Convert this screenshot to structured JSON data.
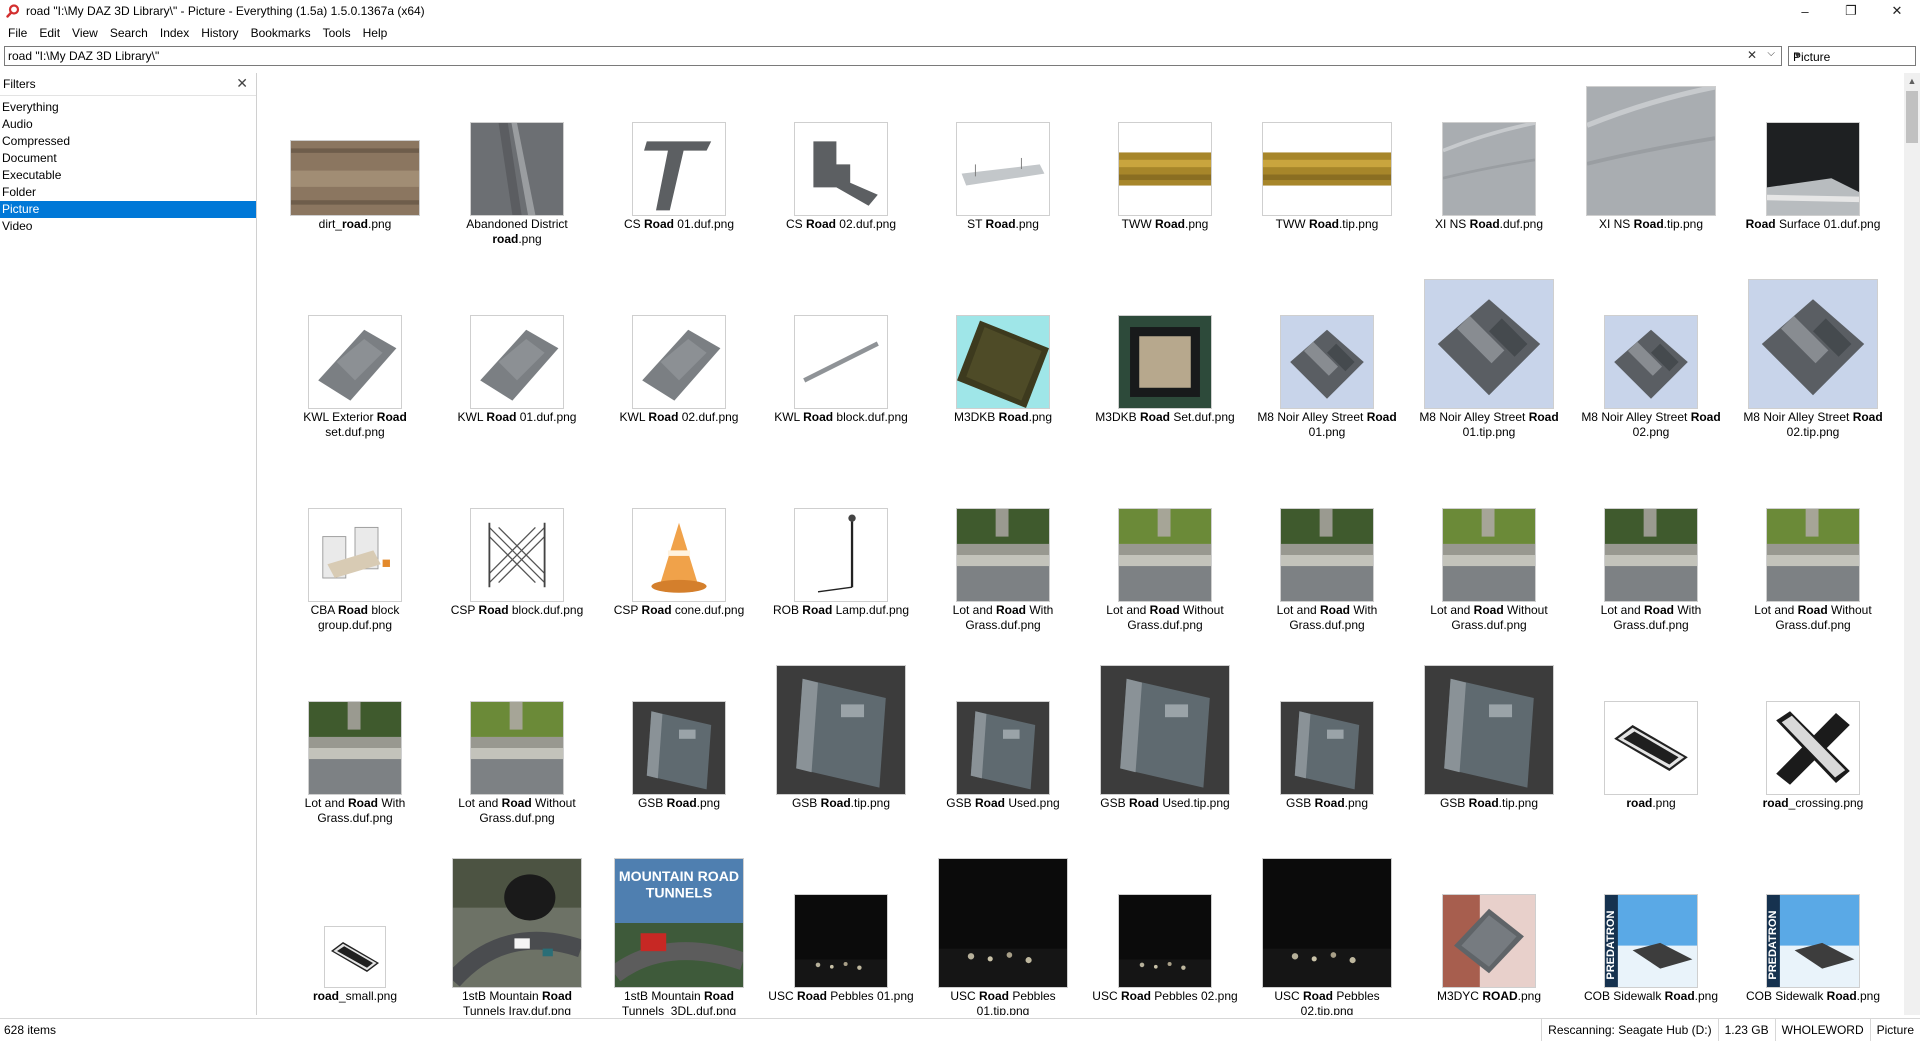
{
  "window": {
    "title": "road \"I:\\My DAZ 3D Library\\\"  - Picture - Everything (1.5a) 1.5.0.1367a (x64)",
    "buttons": {
      "minimize": "–",
      "maximize": "❐",
      "close": "✕"
    }
  },
  "menu": [
    "File",
    "Edit",
    "View",
    "Search",
    "Index",
    "History",
    "Bookmarks",
    "Tools",
    "Help"
  ],
  "search": {
    "value": "road \"I:\\My DAZ 3D Library\\\"",
    "clear_glyph": "✕",
    "dropdown_glyph": "⌵"
  },
  "filter_select": {
    "value": "Picture"
  },
  "sidebar": {
    "title": "Filters",
    "close_glyph": "✕",
    "items": [
      "Everything",
      "Audio",
      "Compressed",
      "Document",
      "Executable",
      "Folder",
      "Picture",
      "Video"
    ],
    "selected": "Picture"
  },
  "files": [
    {
      "pre": "dirt_",
      "bold": "road",
      "post": ".png",
      "thumb": "dirt",
      "w": 128,
      "h": 74
    },
    {
      "pre": "Abandoned District ",
      "bold": "road",
      "post": ".png",
      "thumb": "gray-dark",
      "w": 92,
      "h": 92
    },
    {
      "pre": "CS ",
      "bold": "Road",
      "post": " 01.duf.png",
      "thumb": "piece-t",
      "w": 92,
      "h": 92
    },
    {
      "pre": "CS ",
      "bold": "Road",
      "post": " 02.duf.png",
      "thumb": "piece-l",
      "w": 92,
      "h": 92
    },
    {
      "pre": "ST ",
      "bold": "Road",
      "post": ".png",
      "thumb": "piece-flat",
      "w": 92,
      "h": 92
    },
    {
      "pre": "TWW ",
      "bold": "Road",
      "post": ".png",
      "thumb": "yellow-strip",
      "w": 92,
      "h": 92
    },
    {
      "pre": "TWW ",
      "bold": "Road",
      "post": ".tip.png",
      "thumb": "yellow-strip",
      "w": 128,
      "h": 92
    },
    {
      "pre": "XI NS ",
      "bold": "Road",
      "post": ".duf.png",
      "thumb": "asphalt-light",
      "w": 92,
      "h": 92
    },
    {
      "pre": "XI NS ",
      "bold": "Road",
      "post": ".tip.png",
      "thumb": "asphalt-light",
      "w": 128,
      "h": 128
    },
    {
      "pre": "",
      "bold": "Road",
      "post": " Surface 01.duf.png",
      "thumb": "black-tile",
      "w": 92,
      "h": 92
    },
    {
      "pre": "KWL Exterior ",
      "bold": "Road",
      "post": " set.duf.png",
      "thumb": "slab",
      "w": 92,
      "h": 92
    },
    {
      "pre": "KWL ",
      "bold": "Road",
      "post": " 01.duf.png",
      "thumb": "slab",
      "w": 92,
      "h": 92
    },
    {
      "pre": "KWL ",
      "bold": "Road",
      "post": " 02.duf.png",
      "thumb": "slab",
      "w": 92,
      "h": 92
    },
    {
      "pre": "KWL ",
      "bold": "Road",
      "post": " block.duf.png",
      "thumb": "stick",
      "w": 92,
      "h": 92
    },
    {
      "pre": "M3DKB ",
      "bold": "Road",
      "post": ".png",
      "thumb": "cyan-tile",
      "w": 92,
      "h": 92
    },
    {
      "pre": "M3DKB ",
      "bold": "Road",
      "post": " Set.duf.png",
      "thumb": "green-tile",
      "w": 92,
      "h": 92
    },
    {
      "pre": "M8 Noir Alley Street ",
      "bold": "Road",
      "post": " 01.png",
      "thumb": "noir",
      "w": 92,
      "h": 92
    },
    {
      "pre": "M8 Noir Alley Street ",
      "bold": "Road",
      "post": " 01.tip.png",
      "thumb": "noir",
      "w": 128,
      "h": 128
    },
    {
      "pre": "M8 Noir Alley Street ",
      "bold": "Road",
      "post": " 02.png",
      "thumb": "noir",
      "w": 92,
      "h": 92
    },
    {
      "pre": "M8 Noir Alley Street ",
      "bold": "Road",
      "post": " 02.tip.png",
      "thumb": "noir",
      "w": 128,
      "h": 128
    },
    {
      "pre": "CBA ",
      "bold": "Road",
      "post": " block group.duf.png",
      "thumb": "barrier",
      "w": 92,
      "h": 92
    },
    {
      "pre": "CSP ",
      "bold": "Road",
      "post": " block.duf.png",
      "thumb": "fence",
      "w": 92,
      "h": 92
    },
    {
      "pre": "CSP ",
      "bold": "Road",
      "post": " cone.duf.png",
      "thumb": "cone",
      "w": 92,
      "h": 92
    },
    {
      "pre": "ROB ",
      "bold": "Road",
      "post": " Lamp.duf.png",
      "thumb": "lamp",
      "w": 92,
      "h": 92
    },
    {
      "pre": "Lot and ",
      "bold": "Road",
      "post": " With Grass.duf.png",
      "thumb": "grass-dark",
      "w": 92,
      "h": 92
    },
    {
      "pre": "Lot and ",
      "bold": "Road",
      "post": " Without Grass.duf.png",
      "thumb": "grass-light",
      "w": 92,
      "h": 92
    },
    {
      "pre": "Lot and ",
      "bold": "Road",
      "post": " With Grass.duf.png",
      "thumb": "grass-dark",
      "w": 92,
      "h": 92
    },
    {
      "pre": "Lot and ",
      "bold": "Road",
      "post": " Without Grass.duf.png",
      "thumb": "grass-light",
      "w": 92,
      "h": 92
    },
    {
      "pre": "Lot and ",
      "bold": "Road",
      "post": " With Grass.duf.png",
      "thumb": "grass-dark",
      "w": 92,
      "h": 92
    },
    {
      "pre": "Lot and ",
      "bold": "Road",
      "post": " Without Grass.duf.png",
      "thumb": "grass-light",
      "w": 92,
      "h": 92
    },
    {
      "pre": "Lot and ",
      "bold": "Road",
      "post": " With Grass.duf.png",
      "thumb": "grass-dark",
      "w": 92,
      "h": 92
    },
    {
      "pre": "Lot and ",
      "bold": "Road",
      "post": " Without Grass.duf.png",
      "thumb": "grass-light",
      "w": 92,
      "h": 92
    },
    {
      "pre": "GSB ",
      "bold": "Road",
      "post": ".png",
      "thumb": "gsb",
      "w": 92,
      "h": 92
    },
    {
      "pre": "GSB ",
      "bold": "Road",
      "post": ".tip.png",
      "thumb": "gsb",
      "w": 128,
      "h": 128
    },
    {
      "pre": "GSB ",
      "bold": "Road",
      "post": " Used.png",
      "thumb": "gsb",
      "w": 92,
      "h": 92
    },
    {
      "pre": "GSB ",
      "bold": "Road",
      "post": " Used.tip.png",
      "thumb": "gsb",
      "w": 128,
      "h": 128
    },
    {
      "pre": "GSB ",
      "bold": "Road",
      "post": ".png",
      "thumb": "gsb",
      "w": 92,
      "h": 92
    },
    {
      "pre": "GSB ",
      "bold": "Road",
      "post": ".tip.png",
      "thumb": "gsb",
      "w": 128,
      "h": 128
    },
    {
      "pre": "",
      "bold": "road",
      "post": ".png",
      "thumb": "speckle-strip",
      "w": 92,
      "h": 92
    },
    {
      "pre": "",
      "bold": "road",
      "post": "_crossing.png",
      "thumb": "crossing",
      "w": 92,
      "h": 92
    },
    {
      "pre": "",
      "bold": "road",
      "post": "_small.png",
      "thumb": "speckle-strip",
      "w": 60,
      "h": 60
    },
    {
      "pre": "1stB Mountain ",
      "bold": "Road",
      "post": " Tunnels Iray.duf.png",
      "thumb": "mountain",
      "w": 128,
      "h": 128
    },
    {
      "pre": "1stB Mountain ",
      "bold": "Road",
      "post": " Tunnels_3DL.duf.png",
      "thumb": "mountain-poster",
      "w": 128,
      "h": 128
    },
    {
      "pre": "USC ",
      "bold": "Road",
      "post": " Pebbles 01.png",
      "thumb": "pebbles",
      "w": 92,
      "h": 92
    },
    {
      "pre": "USC ",
      "bold": "Road",
      "post": " Pebbles 01.tip.png",
      "thumb": "pebbles",
      "w": 128,
      "h": 128
    },
    {
      "pre": "USC ",
      "bold": "Road",
      "post": " Pebbles 02.png",
      "thumb": "pebbles",
      "w": 92,
      "h": 92
    },
    {
      "pre": "USC ",
      "bold": "Road",
      "post": " Pebbles 02.tip.png",
      "thumb": "pebbles",
      "w": 128,
      "h": 128
    },
    {
      "pre": "M3DYC ",
      "bold": "ROAD",
      "post": ".png",
      "thumb": "brown-tile",
      "w": 92,
      "h": 92
    },
    {
      "pre": "COB Sidewalk ",
      "bold": "Road",
      "post": ".png",
      "thumb": "predatron",
      "w": 92,
      "h": 92
    },
    {
      "pre": "COB Sidewalk ",
      "bold": "Road",
      "post": ".png",
      "thumb": "predatron",
      "w": 92,
      "h": 92
    }
  ],
  "thumb_text": {
    "mountain_poster": "MOUNTAIN ROAD TUNNELS",
    "predatron": "PREDATRON"
  },
  "status": {
    "count": "628 items",
    "segments": [
      "Rescanning: Seagate Hub (D:)",
      "1.23 GB",
      "WHOLEWORD",
      "Picture"
    ]
  },
  "colors": {
    "selection": "#0078d7"
  }
}
